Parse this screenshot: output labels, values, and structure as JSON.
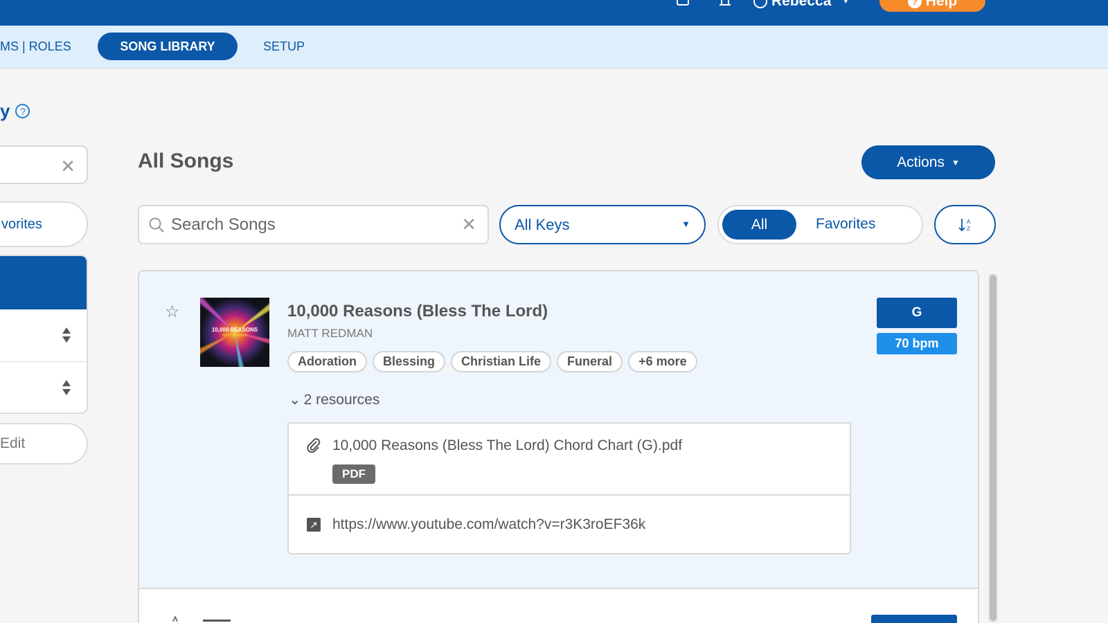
{
  "topbar": {
    "user_name": "Rebecca",
    "help_label": "Help"
  },
  "subnav": {
    "items": [
      {
        "label": "MS | ROLES"
      },
      {
        "label": "SONG LIBRARY"
      },
      {
        "label": "SETUP"
      }
    ]
  },
  "left_panel": {
    "title_fragment": "y",
    "favorites_label": "vorites",
    "edit_label": "Edit"
  },
  "main": {
    "title": "All Songs",
    "actions_label": "Actions",
    "search_placeholder": "Search Songs",
    "keys_select_value": "All Keys",
    "toggle_all": "All",
    "toggle_favorites": "Favorites"
  },
  "song": {
    "title": "10,000 Reasons (Bless The Lord)",
    "artist": "MATT REDMAN",
    "cover_text": "10,000 REASONS",
    "cover_subtext": "MATT REDMAN",
    "tags": [
      "Adoration",
      "Blessing",
      "Christian Life",
      "Funeral",
      "+6 more"
    ],
    "resources_toggle": "2 resources",
    "key": "G",
    "bpm": "70 bpm",
    "resources": [
      {
        "name": "10,000 Reasons (Bless The Lord) Chord Chart (G).pdf",
        "badge": "PDF"
      },
      {
        "name": "https://www.youtube.com/watch?v=r3K3roEF36k"
      }
    ]
  },
  "colors": {
    "primary": "#0b57a8",
    "accent_orange": "#f68b2c",
    "bpm_blue": "#1e8fe8",
    "subnav_bg": "#deeefb",
    "card_bg": "#eef5fc"
  }
}
